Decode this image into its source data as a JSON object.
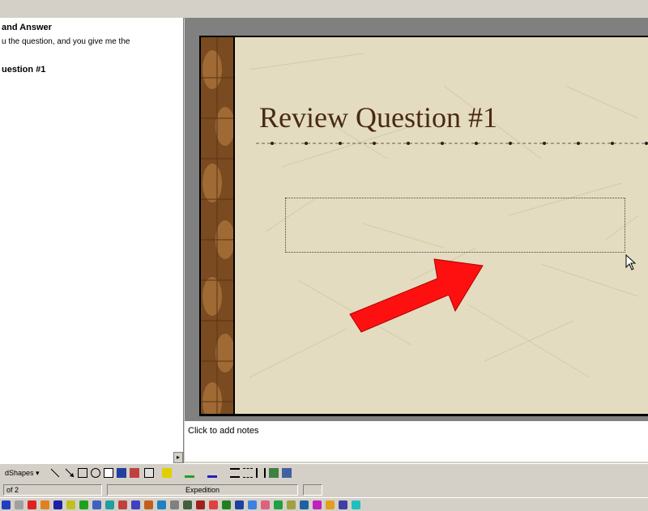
{
  "outline": {
    "title": "and Answer",
    "body": "u the question, and you give me the",
    "slide2": "uestion #1"
  },
  "slide": {
    "title": "Review Question #1"
  },
  "notes": {
    "placeholder": "Click to add notes"
  },
  "drawing_toolbar": {
    "autoshapes_label": "dShapes ▾"
  },
  "status_bar": {
    "slide_count": "of 2",
    "design": "Expedition"
  },
  "colors": {
    "slide_bg": "#e4dcc0",
    "title_color": "#4a2a14",
    "arrow": "#ff0000",
    "frame_gray": "#808080"
  }
}
